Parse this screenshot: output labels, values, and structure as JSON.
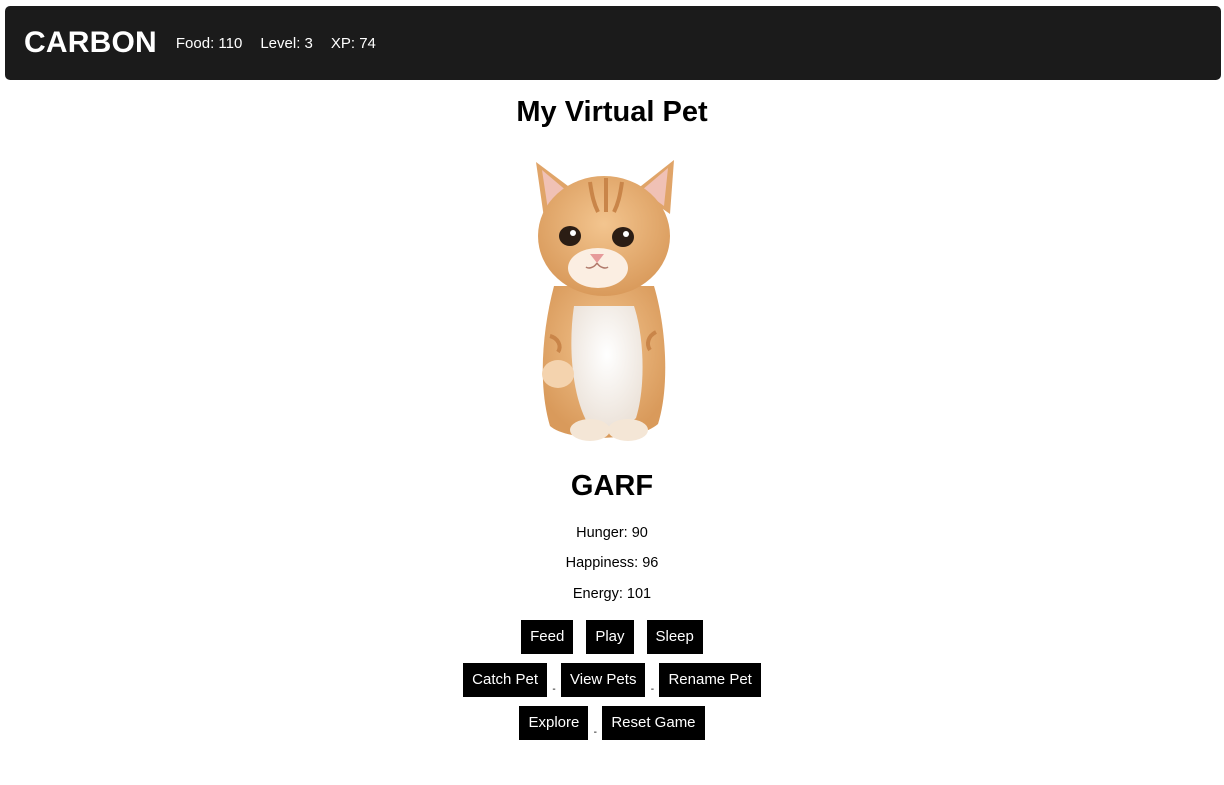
{
  "header": {
    "brand": "CARBON",
    "food": "Food: 110",
    "level": "Level: 3",
    "xp": "XP: 74"
  },
  "main": {
    "title": "My Virtual Pet",
    "pet_image_icon": "kitten-image",
    "pet_name": "GARF",
    "stats": {
      "hunger": "Hunger: 90",
      "happiness": "Happiness: 96",
      "energy": "Energy: 101"
    }
  },
  "actions": {
    "feed": "Feed",
    "play": "Play",
    "sleep": "Sleep",
    "catch_pet": "Catch Pet",
    "view_pets": "View Pets",
    "rename_pet": "Rename Pet",
    "explore": "Explore",
    "reset_game": "Reset Game",
    "separator": "-"
  },
  "colors": {
    "header_bg": "#1b1b1b",
    "button_bg": "#000000",
    "button_text": "#ffffff"
  }
}
